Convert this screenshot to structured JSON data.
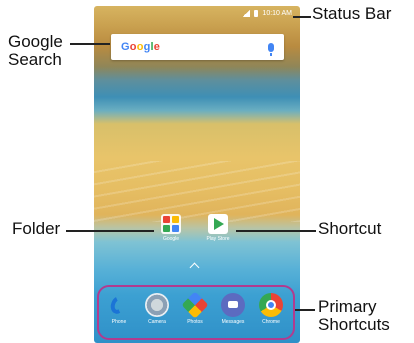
{
  "callouts": {
    "status_bar": "Status Bar",
    "google_search_line1": "Google",
    "google_search_line2": "Search",
    "folder": "Folder",
    "shortcut": "Shortcut",
    "primary_line1": "Primary",
    "primary_line2": "Shortcuts"
  },
  "status": {
    "time": "10:10 AM"
  },
  "search": {
    "logo": "Google"
  },
  "home_icons": [
    {
      "label": "Google",
      "icon": "folder-icon"
    },
    {
      "label": "Play Store",
      "icon": "play-store-icon"
    }
  ],
  "dock": [
    {
      "label": "Phone",
      "icon": "phone-icon"
    },
    {
      "label": "Camera",
      "icon": "camera-icon"
    },
    {
      "label": "Photos",
      "icon": "photos-icon"
    },
    {
      "label": "Messages",
      "icon": "messages-icon"
    },
    {
      "label": "Chrome",
      "icon": "chrome-icon"
    }
  ],
  "colors": {
    "dock_outline": "#b13b8f",
    "google_blue": "#4285f4"
  }
}
